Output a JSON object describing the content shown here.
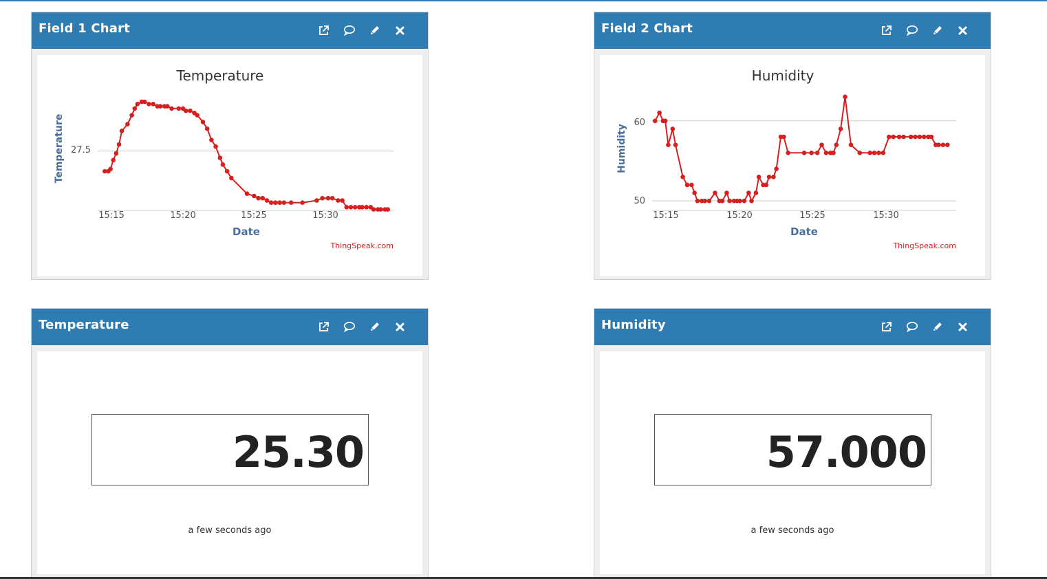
{
  "widgets": [
    {
      "title": "Field 1 Chart",
      "chart": {
        "title": "Temperature",
        "ylabel": "Temperature",
        "xlabel": "Date",
        "credit": "ThingSpeak.com",
        "ytick_label": "27.5",
        "xtick_labels": [
          "15:15",
          "15:20",
          "15:25",
          "15:30"
        ]
      }
    },
    {
      "title": "Field 2 Chart",
      "chart": {
        "title": "Humidity",
        "ylabel": "Humidity",
        "xlabel": "Date",
        "credit": "ThingSpeak.com",
        "ytick_labels": [
          "60",
          "50"
        ],
        "xtick_labels": [
          "15:15",
          "15:20",
          "15:25",
          "15:30"
        ]
      }
    },
    {
      "title": "Temperature",
      "value": "25.30",
      "updated": "a few seconds ago"
    },
    {
      "title": "Humidity",
      "value": "57.000",
      "updated": "a few seconds ago"
    }
  ],
  "icons": [
    "external-link-icon",
    "comment-icon",
    "pencil-icon",
    "close-icon"
  ],
  "colors": {
    "header": "#2e7cb2",
    "series": "#d62020",
    "axis_label": "#4a6f9d",
    "credit": "#cc2222"
  },
  "chart_data": [
    {
      "type": "line",
      "title": "Temperature",
      "xlabel": "Date",
      "ylabel": "Temperature",
      "x_unit": "minutes",
      "xticks": [
        "15:15",
        "15:20",
        "15:25",
        "15:30"
      ],
      "ylim": [
        26.3,
        28.8
      ],
      "grid": true,
      "series": [
        {
          "x": [
            14.5,
            14.75,
            14.9,
            15.1,
            15.3,
            15.5,
            15.7,
            16.1,
            16.4,
            16.6,
            16.8,
            17.1,
            17.3,
            17.6,
            17.9,
            18.2,
            18.4,
            18.7,
            18.9,
            19.2,
            19.7,
            20.0,
            20.2,
            20.5,
            20.8,
            21.0,
            21.4,
            21.7,
            22.0,
            22.3,
            22.6,
            22.8,
            23.1,
            23.4,
            24.5,
            25.0,
            25.3,
            25.6,
            25.9,
            26.2,
            26.5,
            26.8,
            27.1,
            27.6,
            28.4,
            29.4,
            29.8,
            30.2,
            30.5,
            30.9,
            31.2,
            31.5,
            31.8,
            32.1,
            32.4,
            32.6,
            32.9,
            33.2,
            33.4,
            33.7,
            33.9,
            34.2,
            34.4
          ],
          "y": [
            27.05,
            27.05,
            27.1,
            27.3,
            27.45,
            27.65,
            27.95,
            28.1,
            28.3,
            28.45,
            28.55,
            28.6,
            28.6,
            28.55,
            28.55,
            28.5,
            28.5,
            28.5,
            28.5,
            28.45,
            28.45,
            28.45,
            28.4,
            28.4,
            28.35,
            28.3,
            28.15,
            28.0,
            27.75,
            27.6,
            27.35,
            27.2,
            27.05,
            26.9,
            26.55,
            26.5,
            26.45,
            26.45,
            26.4,
            26.35,
            26.35,
            26.35,
            26.35,
            26.35,
            26.35,
            26.4,
            26.45,
            26.45,
            26.45,
            26.4,
            26.4,
            26.25,
            26.25,
            26.25,
            26.25,
            26.25,
            26.25,
            26.25,
            26.2,
            26.2,
            26.2,
            26.2,
            26.2
          ]
        }
      ]
    },
    {
      "type": "line",
      "title": "Humidity",
      "xlabel": "Date",
      "ylabel": "Humidity",
      "x_unit": "minutes",
      "xticks": [
        "15:15",
        "15:20",
        "15:25",
        "15:30"
      ],
      "ylim": [
        49.5,
        63.5
      ],
      "grid": true,
      "series": [
        {
          "x": [
            14.2,
            14.5,
            14.75,
            14.9,
            15.1,
            15.4,
            15.6,
            16.1,
            16.4,
            16.7,
            16.9,
            17.1,
            17.4,
            17.6,
            17.9,
            18.3,
            18.6,
            18.8,
            19.1,
            19.3,
            19.6,
            19.8,
            20.0,
            20.3,
            20.6,
            20.8,
            21.1,
            21.3,
            21.6,
            21.8,
            22.0,
            22.3,
            22.5,
            22.8,
            23.0,
            23.3,
            24.4,
            24.9,
            25.3,
            25.6,
            25.9,
            26.2,
            26.4,
            26.6,
            26.9,
            27.2,
            27.6,
            28.2,
            28.9,
            29.2,
            29.5,
            29.8,
            30.2,
            30.5,
            30.9,
            31.2,
            31.7,
            32.0,
            32.3,
            32.6,
            32.9,
            33.1,
            33.4,
            33.6,
            33.9,
            34.2
          ],
          "y": [
            60,
            61,
            60,
            60,
            57,
            59,
            57,
            53,
            52,
            52,
            51,
            50,
            50,
            50,
            50,
            51,
            50,
            50,
            51,
            50,
            50,
            50,
            50,
            50,
            51,
            50,
            51,
            53,
            52,
            52,
            53,
            53,
            54,
            58,
            58,
            56,
            56,
            56,
            56,
            57,
            56,
            56,
            56,
            57,
            59,
            63,
            57,
            56,
            56,
            56,
            56,
            56,
            58,
            58,
            58,
            58,
            58,
            58,
            58,
            58,
            58,
            58,
            57,
            57,
            57,
            57
          ]
        }
      ]
    }
  ]
}
